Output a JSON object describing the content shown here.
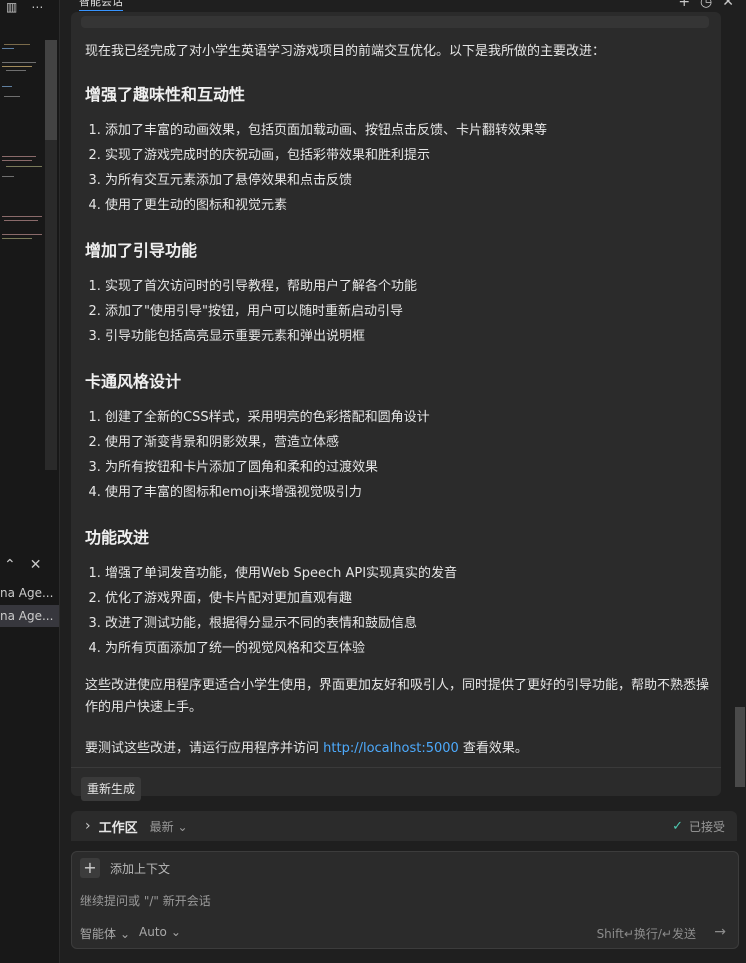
{
  "left_strip": {
    "panel_items": [
      "na Age...",
      "na Age..."
    ]
  },
  "tab": {
    "title": "智能会话"
  },
  "message": {
    "intro": "现在我已经完成了对小学生英语学习游戏项目的前端交互优化。以下是我所做的主要改进：",
    "sections": [
      {
        "heading": "增强了趣味性和互动性",
        "items": [
          "添加了丰富的动画效果，包括页面加载动画、按钮点击反馈、卡片翻转效果等",
          "实现了游戏完成时的庆祝动画，包括彩带效果和胜利提示",
          "为所有交互元素添加了悬停效果和点击反馈",
          "使用了更生动的图标和视觉元素"
        ]
      },
      {
        "heading": "增加了引导功能",
        "items": [
          "实现了首次访问时的引导教程，帮助用户了解各个功能",
          "添加了\"使用引导\"按钮，用户可以随时重新启动引导",
          "引导功能包括高亮显示重要元素和弹出说明框"
        ]
      },
      {
        "heading": "卡通风格设计",
        "items": [
          "创建了全新的CSS样式，采用明亮的色彩搭配和圆角设计",
          "使用了渐变背景和阴影效果，营造立体感",
          "为所有按钮和卡片添加了圆角和柔和的过渡效果",
          "使用了丰富的图标和emoji来增强视觉吸引力"
        ]
      },
      {
        "heading": "功能改进",
        "items": [
          "增强了单词发音功能，使用Web Speech API实现真实的发音",
          "优化了游戏界面，使卡片配对更加直观有趣",
          "改进了测试功能，根据得分显示不同的表情和鼓励信息",
          "为所有页面添加了统一的视觉风格和交互体验"
        ]
      }
    ],
    "conclusion": "这些改进使应用程序更适合小学生使用，界面更加友好和吸引人，同时提供了更好的引导功能，帮助不熟悉操作的用户快速上手。",
    "test_before": "要测试这些改进，请运行应用程序并访问 ",
    "test_link": "http://localhost:5000",
    "test_after": " 查看效果。",
    "regenerate_label": "重新生成"
  },
  "workspace": {
    "title": "工作区",
    "latest_label": "最新",
    "status": "已接受"
  },
  "input": {
    "add_context_label": "添加上下文",
    "placeholder": "继续提问或 \"/\" 新开会话",
    "agent_label": "智能体",
    "model_label": "Auto",
    "shortcut_hint": "Shift↵换行/↵发送"
  },
  "colors": {
    "link": "#4daafc",
    "accepted": "#4ec9b0",
    "accent": "#3794ff"
  }
}
